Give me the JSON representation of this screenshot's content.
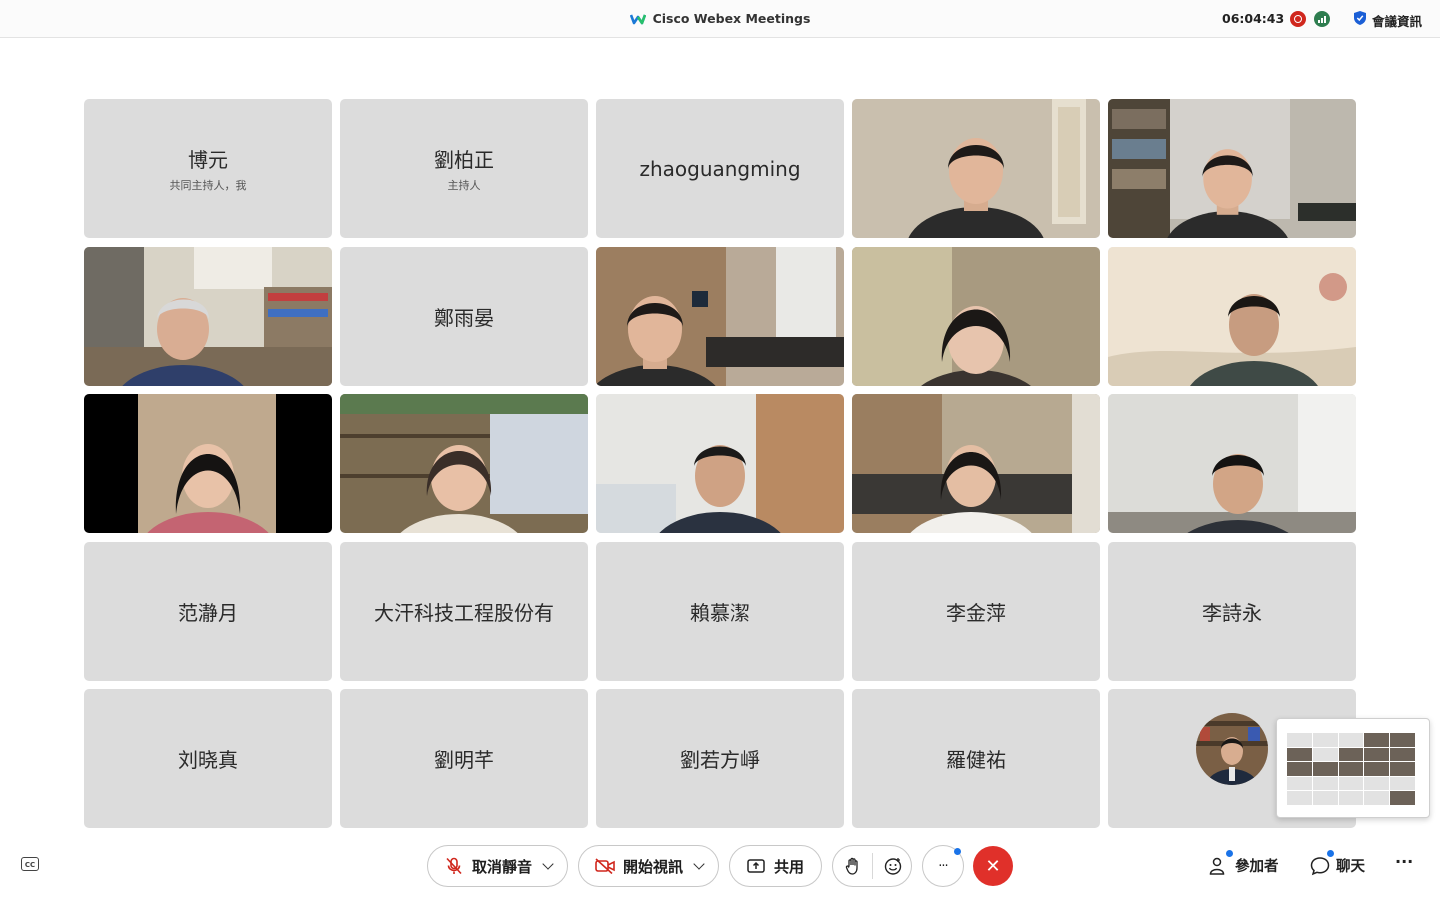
{
  "window": {
    "title": "Cisco Webex Meetings",
    "clock": "06:04:43",
    "meeting_info_label": "會議資訊"
  },
  "participants": [
    {
      "name": "博元",
      "role": "共同主持人，我",
      "video": false
    },
    {
      "name": "劉柏正",
      "role": "主持人",
      "video": false
    },
    {
      "name": "zhaoguangming",
      "role": "",
      "video": false
    },
    {
      "name": "",
      "role": "",
      "video": true
    },
    {
      "name": "",
      "role": "",
      "video": true
    },
    {
      "name": "",
      "role": "",
      "video": true
    },
    {
      "name": "鄭雨晏",
      "role": "",
      "video": false
    },
    {
      "name": "",
      "role": "",
      "video": true
    },
    {
      "name": "",
      "role": "",
      "video": true
    },
    {
      "name": "",
      "role": "",
      "video": true
    },
    {
      "name": "",
      "role": "",
      "video": true
    },
    {
      "name": "",
      "role": "",
      "video": true
    },
    {
      "name": "",
      "role": "",
      "video": true
    },
    {
      "name": "",
      "role": "",
      "video": true
    },
    {
      "name": "",
      "role": "",
      "video": true
    },
    {
      "name": "范瀞月",
      "role": "",
      "video": false
    },
    {
      "name": "大汗科技工程股份有",
      "role": "",
      "video": false
    },
    {
      "name": "賴慕潔",
      "role": "",
      "video": false
    },
    {
      "name": "李金萍",
      "role": "",
      "video": false
    },
    {
      "name": "李詩永",
      "role": "",
      "video": false
    },
    {
      "name": "刘晓真",
      "role": "",
      "video": false
    },
    {
      "name": "劉明芊",
      "role": "",
      "video": false
    },
    {
      "name": "劉若方崢",
      "role": "",
      "video": false
    },
    {
      "name": "羅健祐",
      "role": "",
      "video": false
    },
    {
      "name": "",
      "role": "",
      "video": false
    }
  ],
  "controls": {
    "unmute_label": "取消靜音",
    "start_video_label": "開始視訊",
    "share_label": "共用",
    "participants_label": "參加者",
    "chat_label": "聊天",
    "more_label": "···",
    "end_label": "✕",
    "cc_label": "CC"
  },
  "colors": {
    "end_button": "#e0302a",
    "recording": "#d0271d",
    "tile_bg": "#dcdcdc",
    "notify_dot": "#1a73e8"
  }
}
